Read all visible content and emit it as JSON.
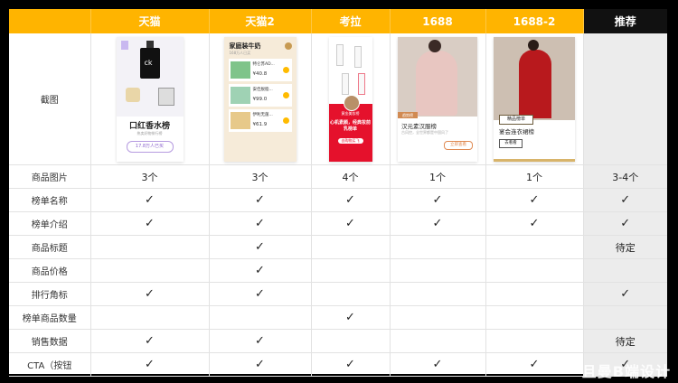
{
  "header": {
    "columns": [
      "",
      "天猫",
      "天猫2",
      "考拉",
      "1688",
      "1688-2",
      "推荐"
    ]
  },
  "screenshot_row_label": "截图",
  "cards": {
    "tmall": {
      "brand": "ck",
      "title": "口红香水榜",
      "subtitle": "热卖好物排行榜",
      "pill": "17.8万人已买"
    },
    "tmall2": {
      "title": "家庭装牛奶",
      "subtitle": "168万人已买",
      "items": [
        {
          "rank": "1",
          "name": "特仑苏AD...",
          "price": "¥40.8"
        },
        {
          "rank": "2",
          "name": "安佳脱脂...",
          "price": "¥99.0"
        },
        {
          "rank": "3",
          "name": "伊利无菌...",
          "price": "¥61.9"
        }
      ]
    },
    "kaola": {
      "name": "黄金美妆榜",
      "headline": "心机素颜，经典妆前乳榜单",
      "button": "去购物买飞"
    },
    "a1688": {
      "tag": "趋势榜",
      "title": "汉元素汉服榜",
      "subtitle": "古风控，全世界都是中国风了",
      "button": "立即查看"
    },
    "a1688_2": {
      "tag": "精品榜单",
      "title": "宴会连衣裙榜",
      "button": "去看看"
    }
  },
  "rows": [
    {
      "label": "商品图片",
      "cells": [
        "3个",
        "3个",
        "4个",
        "1个",
        "1个",
        "3-4个"
      ]
    },
    {
      "label": "榜单名称",
      "cells": [
        "✓",
        "✓",
        "✓",
        "✓",
        "✓",
        "✓"
      ]
    },
    {
      "label": "榜单介绍",
      "cells": [
        "✓",
        "✓",
        "✓",
        "✓",
        "✓",
        "✓"
      ]
    },
    {
      "label": "商品标题",
      "cells": [
        "",
        "✓",
        "",
        "",
        "",
        "待定"
      ]
    },
    {
      "label": "商品价格",
      "cells": [
        "",
        "✓",
        "",
        "",
        "",
        ""
      ]
    },
    {
      "label": "排行角标",
      "cells": [
        "✓",
        "✓",
        "",
        "",
        "",
        "✓"
      ]
    },
    {
      "label": "榜单商品数量",
      "cells": [
        "",
        "",
        "✓",
        "",
        "",
        ""
      ]
    },
    {
      "label": "销售数据",
      "cells": [
        "✓",
        "✓",
        "",
        "",
        "",
        "待定"
      ]
    },
    {
      "label": "CTA（按钮",
      "cells": [
        "✓",
        "✓",
        "✓",
        "✓",
        "✓",
        "✓"
      ]
    }
  ],
  "watermark": "且曼B端设计",
  "colors": {
    "header": "#ffb400",
    "recommend_header": "#111111",
    "recommend_col": "#ececec"
  }
}
